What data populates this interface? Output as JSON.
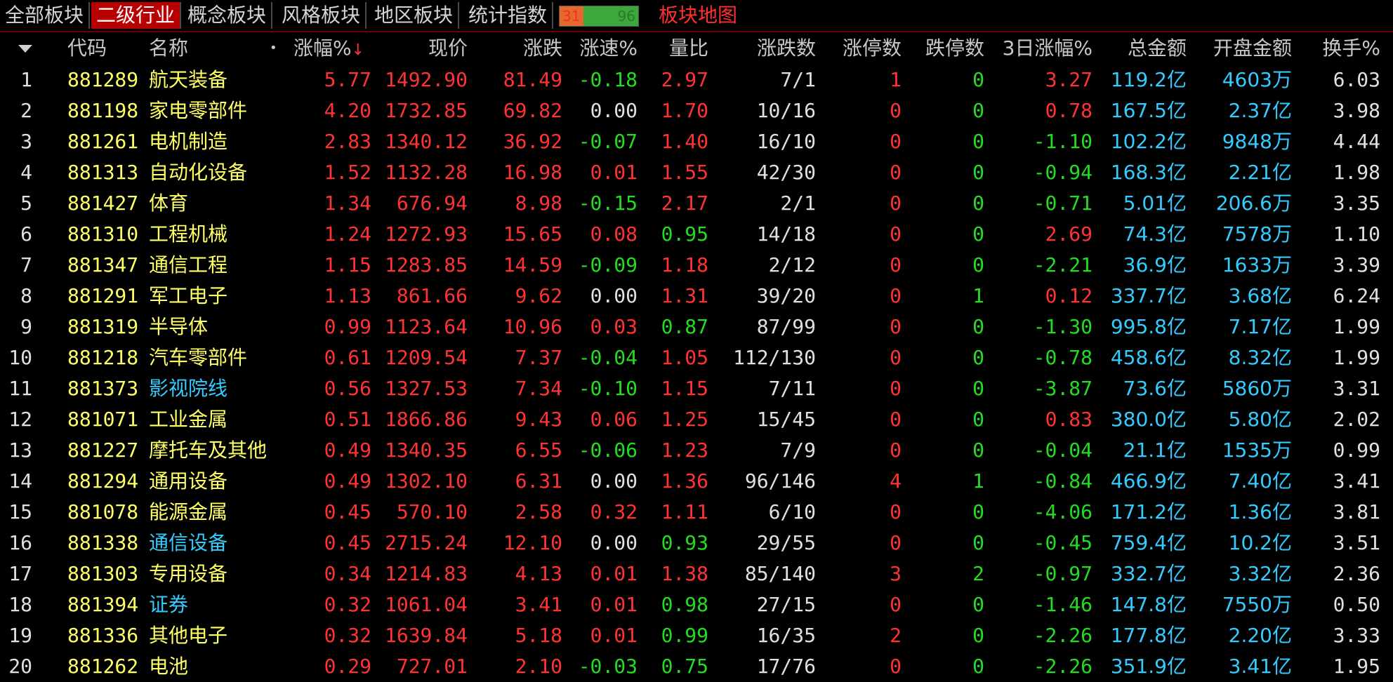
{
  "tabs": [
    {
      "label": "全部板块",
      "active": false
    },
    {
      "label": "二级行业",
      "active": true
    },
    {
      "label": "概念板块",
      "active": false
    },
    {
      "label": "风格板块",
      "active": false
    },
    {
      "label": "地区板块",
      "active": false
    },
    {
      "label": "统计指数",
      "active": false
    }
  ],
  "updown_ratio": {
    "up": "31",
    "down": "96"
  },
  "map_link": "板块地图",
  "columns": {
    "code": "代码",
    "name": "名称",
    "pct": "涨幅%",
    "price": "现价",
    "change": "涨跌",
    "speed": "涨速%",
    "volratio": "量比",
    "updown": "涨跌数",
    "limitup": "涨停数",
    "limitdown": "跌停数",
    "pct3d": "3日涨幅%",
    "amount": "总金额",
    "open_amount": "开盘金额",
    "turnover": "换手%"
  },
  "sort_indicator": "↓",
  "name_dot": "•",
  "rows": [
    {
      "idx": "1",
      "code": "881289",
      "name": "航天装备",
      "pct": "5.77",
      "price": "1492.90",
      "change": "81.49",
      "speed": "-0.18",
      "volratio": "2.97",
      "updown": "7/1",
      "limitup": "1",
      "limitdown": "0",
      "pct3d": "3.27",
      "amount": "119.2亿",
      "open_amount": "4603万",
      "turnover": "6.03"
    },
    {
      "idx": "2",
      "code": "881198",
      "name": "家电零部件",
      "pct": "4.20",
      "price": "1732.85",
      "change": "69.82",
      "speed": "0.00",
      "volratio": "1.70",
      "updown": "10/16",
      "limitup": "0",
      "limitdown": "0",
      "pct3d": "0.78",
      "amount": "167.5亿",
      "open_amount": "2.37亿",
      "turnover": "3.98"
    },
    {
      "idx": "3",
      "code": "881261",
      "name": "电机制造",
      "pct": "2.83",
      "price": "1340.12",
      "change": "36.92",
      "speed": "-0.07",
      "volratio": "1.40",
      "updown": "16/10",
      "limitup": "0",
      "limitdown": "0",
      "pct3d": "-1.10",
      "amount": "102.2亿",
      "open_amount": "9848万",
      "turnover": "4.44"
    },
    {
      "idx": "4",
      "code": "881313",
      "name": "自动化设备",
      "pct": "1.52",
      "price": "1132.28",
      "change": "16.98",
      "speed": "0.01",
      "volratio": "1.55",
      "updown": "42/30",
      "limitup": "0",
      "limitdown": "0",
      "pct3d": "-0.94",
      "amount": "168.3亿",
      "open_amount": "2.21亿",
      "turnover": "1.98"
    },
    {
      "idx": "5",
      "code": "881427",
      "name": "体育",
      "pct": "1.34",
      "price": "676.94",
      "change": "8.98",
      "speed": "-0.15",
      "volratio": "2.17",
      "updown": "2/1",
      "limitup": "0",
      "limitdown": "0",
      "pct3d": "-0.71",
      "amount": "5.01亿",
      "open_amount": "206.6万",
      "turnover": "3.35"
    },
    {
      "idx": "6",
      "code": "881310",
      "name": "工程机械",
      "pct": "1.24",
      "price": "1272.93",
      "change": "15.65",
      "speed": "0.08",
      "volratio": "0.95",
      "updown": "14/18",
      "limitup": "0",
      "limitdown": "0",
      "pct3d": "2.69",
      "amount": "74.3亿",
      "open_amount": "7578万",
      "turnover": "1.10"
    },
    {
      "idx": "7",
      "code": "881347",
      "name": "通信工程",
      "pct": "1.15",
      "price": "1283.85",
      "change": "14.59",
      "speed": "-0.09",
      "volratio": "1.18",
      "updown": "2/12",
      "limitup": "0",
      "limitdown": "0",
      "pct3d": "-2.21",
      "amount": "36.9亿",
      "open_amount": "1633万",
      "turnover": "3.39"
    },
    {
      "idx": "8",
      "code": "881291",
      "name": "军工电子",
      "pct": "1.13",
      "price": "861.66",
      "change": "9.62",
      "speed": "0.00",
      "volratio": "1.31",
      "updown": "39/20",
      "limitup": "0",
      "limitdown": "1",
      "pct3d": "0.12",
      "amount": "337.7亿",
      "open_amount": "3.68亿",
      "turnover": "6.24"
    },
    {
      "idx": "9",
      "code": "881319",
      "name": "半导体",
      "pct": "0.99",
      "price": "1123.64",
      "change": "10.96",
      "speed": "0.03",
      "volratio": "0.87",
      "updown": "87/99",
      "limitup": "0",
      "limitdown": "0",
      "pct3d": "-1.30",
      "amount": "995.8亿",
      "open_amount": "7.17亿",
      "turnover": "1.99"
    },
    {
      "idx": "10",
      "code": "881218",
      "name": "汽车零部件",
      "pct": "0.61",
      "price": "1209.54",
      "change": "7.37",
      "speed": "-0.04",
      "volratio": "1.05",
      "updown": "112/130",
      "limitup": "0",
      "limitdown": "0",
      "pct3d": "-0.78",
      "amount": "458.6亿",
      "open_amount": "8.32亿",
      "turnover": "1.99"
    },
    {
      "idx": "11",
      "code": "881373",
      "name": "影视院线",
      "pct": "0.56",
      "price": "1327.53",
      "change": "7.34",
      "speed": "-0.10",
      "volratio": "1.15",
      "updown": "7/11",
      "limitup": "0",
      "limitdown": "0",
      "pct3d": "-3.87",
      "amount": "73.6亿",
      "open_amount": "5860万",
      "turnover": "3.31",
      "cyan_name": true
    },
    {
      "idx": "12",
      "code": "881071",
      "name": "工业金属",
      "pct": "0.51",
      "price": "1866.86",
      "change": "9.43",
      "speed": "0.06",
      "volratio": "1.25",
      "updown": "15/45",
      "limitup": "0",
      "limitdown": "0",
      "pct3d": "0.83",
      "amount": "380.0亿",
      "open_amount": "5.80亿",
      "turnover": "2.02"
    },
    {
      "idx": "13",
      "code": "881227",
      "name": "摩托车及其他",
      "pct": "0.49",
      "price": "1340.35",
      "change": "6.55",
      "speed": "-0.06",
      "volratio": "1.23",
      "updown": "7/9",
      "limitup": "0",
      "limitdown": "0",
      "pct3d": "-0.04",
      "amount": "21.1亿",
      "open_amount": "1535万",
      "turnover": "0.99"
    },
    {
      "idx": "14",
      "code": "881294",
      "name": "通用设备",
      "pct": "0.49",
      "price": "1302.10",
      "change": "6.31",
      "speed": "0.00",
      "volratio": "1.36",
      "updown": "96/146",
      "limitup": "4",
      "limitdown": "1",
      "pct3d": "-0.84",
      "amount": "466.9亿",
      "open_amount": "7.40亿",
      "turnover": "3.41"
    },
    {
      "idx": "15",
      "code": "881078",
      "name": "能源金属",
      "pct": "0.45",
      "price": "570.10",
      "change": "2.58",
      "speed": "0.32",
      "volratio": "1.11",
      "updown": "6/10",
      "limitup": "0",
      "limitdown": "0",
      "pct3d": "-4.06",
      "amount": "171.2亿",
      "open_amount": "1.36亿",
      "turnover": "3.81"
    },
    {
      "idx": "16",
      "code": "881338",
      "name": "通信设备",
      "pct": "0.45",
      "price": "2715.24",
      "change": "12.10",
      "speed": "0.00",
      "volratio": "0.93",
      "updown": "29/55",
      "limitup": "0",
      "limitdown": "0",
      "pct3d": "-0.45",
      "amount": "759.4亿",
      "open_amount": "10.2亿",
      "turnover": "3.51",
      "cyan_name": true
    },
    {
      "idx": "17",
      "code": "881303",
      "name": "专用设备",
      "pct": "0.34",
      "price": "1214.83",
      "change": "4.13",
      "speed": "0.01",
      "volratio": "1.38",
      "updown": "85/140",
      "limitup": "3",
      "limitdown": "2",
      "pct3d": "-0.97",
      "amount": "332.7亿",
      "open_amount": "3.32亿",
      "turnover": "2.36"
    },
    {
      "idx": "18",
      "code": "881394",
      "name": "证券",
      "pct": "0.32",
      "price": "1061.04",
      "change": "3.41",
      "speed": "0.01",
      "volratio": "0.98",
      "updown": "27/15",
      "limitup": "0",
      "limitdown": "0",
      "pct3d": "-1.46",
      "amount": "147.8亿",
      "open_amount": "7550万",
      "turnover": "0.50",
      "cyan_name": true
    },
    {
      "idx": "19",
      "code": "881336",
      "name": "其他电子",
      "pct": "0.32",
      "price": "1639.84",
      "change": "5.18",
      "speed": "0.01",
      "volratio": "0.99",
      "updown": "16/35",
      "limitup": "2",
      "limitdown": "0",
      "pct3d": "-2.26",
      "amount": "177.8亿",
      "open_amount": "2.20亿",
      "turnover": "3.33"
    },
    {
      "idx": "20",
      "code": "881262",
      "name": "电池",
      "pct": "0.29",
      "price": "727.01",
      "change": "2.10",
      "speed": "-0.03",
      "volratio": "0.75",
      "updown": "17/76",
      "limitup": "0",
      "limitdown": "0",
      "pct3d": "-2.26",
      "amount": "351.9亿",
      "open_amount": "3.41亿",
      "turnover": "1.95"
    }
  ],
  "colors": {
    "up": "#ff3333",
    "down": "#22dd22",
    "flat": "#e0e0e0",
    "code": "#ffff66",
    "name": "#ffff66",
    "money": "#33ccff",
    "active_tab": "#b80000"
  }
}
